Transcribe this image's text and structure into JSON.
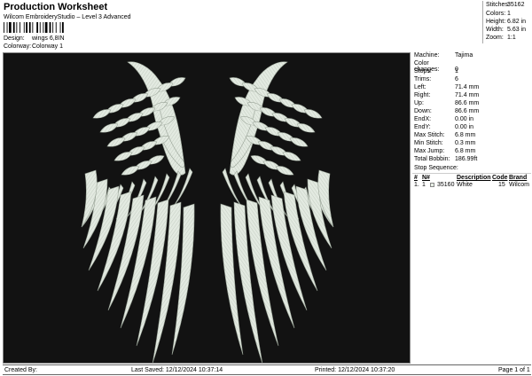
{
  "header": {
    "title": "Production Worksheet",
    "subtitle": "Wilcom EmbroideryStudio – Level 3 Advanced",
    "design_label": "Design:",
    "design_value": "wings 6,8IN",
    "colorway_label": "Colorway:",
    "colorway_value": "Colorway 1"
  },
  "stats": [
    {
      "label": "Stitches:",
      "value": "35162"
    },
    {
      "label": "Colors:",
      "value": "1"
    },
    {
      "label": "Height:",
      "value": "6.82 in"
    },
    {
      "label": "Width:",
      "value": "5.63 in"
    },
    {
      "label": "Zoom:",
      "value": "1:1"
    }
  ],
  "machine": [
    {
      "label": "Machine:",
      "value": "Tajima"
    },
    {
      "label": "Color changes:",
      "value": "0"
    },
    {
      "label": "Stops:",
      "value": "1"
    },
    {
      "label": "Trims:",
      "value": "6"
    },
    {
      "label": "Left:",
      "value": "71.4 mm"
    },
    {
      "label": "Right:",
      "value": "71.4 mm"
    },
    {
      "label": "Up:",
      "value": "86.6 mm"
    },
    {
      "label": "Down:",
      "value": "86.6 mm"
    },
    {
      "label": "EndX:",
      "value": "0.00 in"
    },
    {
      "label": "EndY:",
      "value": "0.00 in"
    },
    {
      "label": "Max Stitch:",
      "value": "6.8 mm"
    },
    {
      "label": "Min Stitch:",
      "value": "0.3 mm"
    },
    {
      "label": "Max Jump:",
      "value": "6.8 mm"
    },
    {
      "label": "Total Bobbin:",
      "value": "186.99ft"
    }
  ],
  "stop_sequence": {
    "title": "Stop Sequence:",
    "headers": [
      "#",
      "N#",
      "Description",
      "Code",
      "Brand"
    ],
    "rows": [
      {
        "num": "1.",
        "n": "1",
        "stitches": "35160",
        "description": "White",
        "code": "15",
        "brand": "Wilcom"
      }
    ]
  },
  "footer": {
    "created": "Created By:",
    "last_saved": "Last Saved: 12/12/2024 10:37:14",
    "printed": "Printed: 12/12/2024 10:37:20",
    "page": "Page 1 of 1"
  },
  "colors": {
    "thread": "#e6ede4",
    "background": "#121212"
  }
}
